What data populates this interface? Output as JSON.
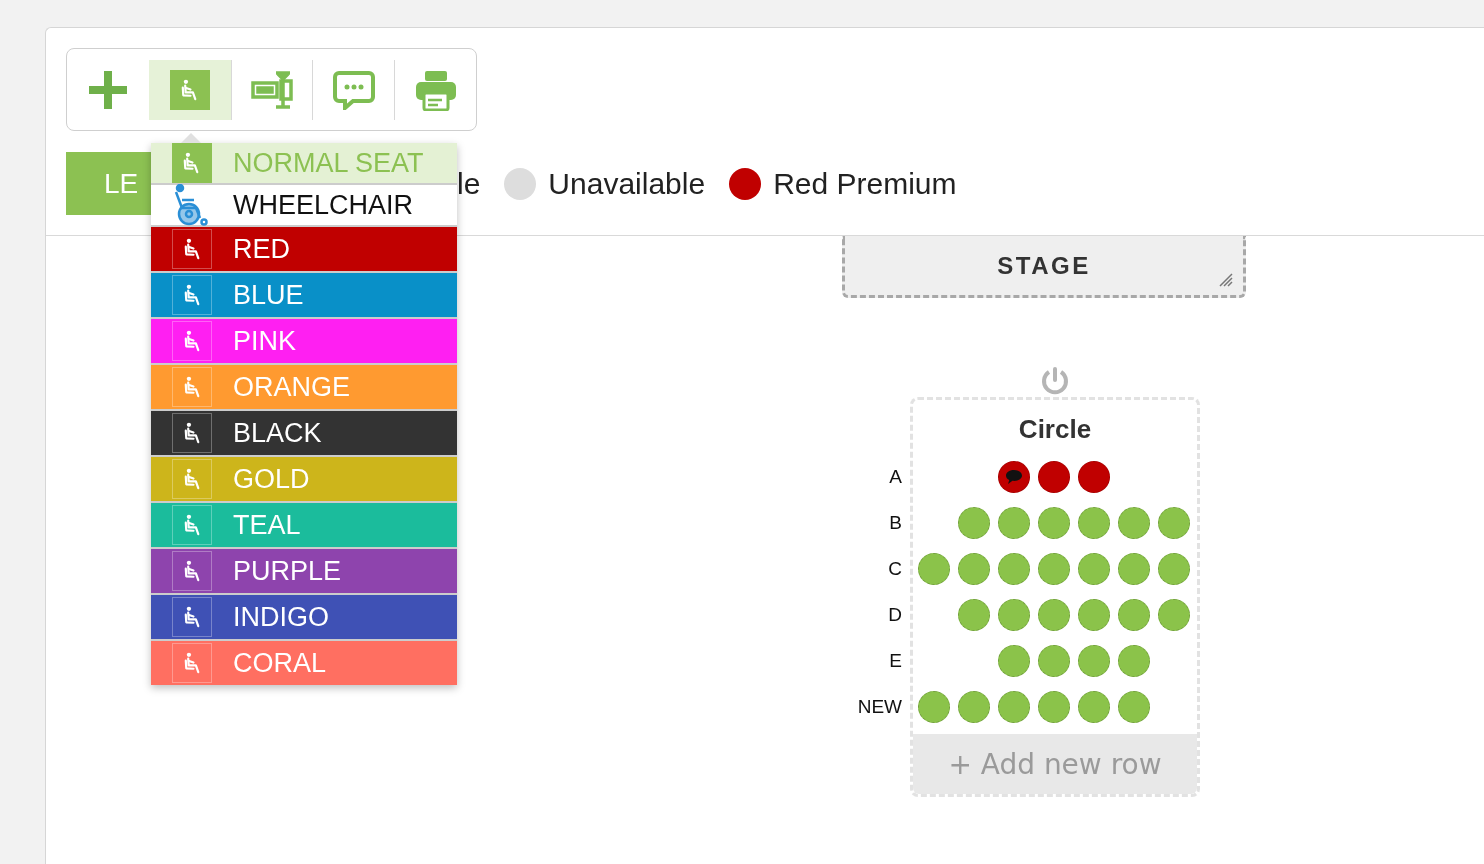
{
  "toolbar": {
    "buttons": [
      {
        "kind": "add",
        "selected": false
      },
      {
        "kind": "seat",
        "selected": true
      },
      {
        "kind": "table",
        "selected": false
      },
      {
        "kind": "comment",
        "selected": false
      },
      {
        "kind": "print",
        "selected": false
      }
    ]
  },
  "legend": {
    "button": "LE",
    "items": [
      {
        "label": "le"
      },
      {
        "label": "Unavailable",
        "color": "#dddddd"
      },
      {
        "label": "Red Premium",
        "color": "#c00000"
      }
    ]
  },
  "seat_menu": {
    "items": [
      {
        "kind": "seat",
        "label": "NORMAL SEAT",
        "selected": true,
        "color": "#e4f1d4"
      },
      {
        "kind": "wheelchair",
        "label": "WHEELCHAIR",
        "selected": false,
        "color": "#ffffff"
      },
      {
        "kind": "seat",
        "label": "RED",
        "selected": false,
        "color": "#c00000"
      },
      {
        "kind": "seat",
        "label": "BLUE",
        "selected": false,
        "color": "#0990c8"
      },
      {
        "kind": "seat",
        "label": "PINK",
        "selected": false,
        "color": "#ff1ff2"
      },
      {
        "kind": "seat",
        "label": "ORANGE",
        "selected": false,
        "color": "#ff9a30"
      },
      {
        "kind": "seat",
        "label": "BLACK",
        "selected": false,
        "color": "#333333"
      },
      {
        "kind": "seat",
        "label": "GOLD",
        "selected": false,
        "color": "#cdb51b"
      },
      {
        "kind": "seat",
        "label": "TEAL",
        "selected": false,
        "color": "#1bbc9c"
      },
      {
        "kind": "seat",
        "label": "PURPLE",
        "selected": false,
        "color": "#8e44ad"
      },
      {
        "kind": "seat",
        "label": "INDIGO",
        "selected": false,
        "color": "#3f51b5"
      },
      {
        "kind": "seat",
        "label": "CORAL",
        "selected": false,
        "color": "#ff6f61"
      }
    ]
  },
  "stage": {
    "label": "STAGE"
  },
  "section": {
    "title": "Circle",
    "add_row": "+ Add new row",
    "rows": [
      {
        "label": "A",
        "seats": [
          {
            "kind": "gap"
          },
          {
            "kind": "gap"
          },
          {
            "kind": "seat",
            "color": "#c00000",
            "note": true
          },
          {
            "kind": "seat",
            "color": "#c00000",
            "note": false
          },
          {
            "kind": "seat",
            "color": "#c00000",
            "note": false
          }
        ]
      },
      {
        "label": "B",
        "seats": [
          {
            "kind": "gap"
          },
          {
            "kind": "seat",
            "color": "#8bc34a",
            "note": false
          },
          {
            "kind": "seat",
            "color": "#8bc34a",
            "note": false
          },
          {
            "kind": "seat",
            "color": "#8bc34a",
            "note": false
          },
          {
            "kind": "seat",
            "color": "#8bc34a",
            "note": false
          },
          {
            "kind": "seat",
            "color": "#8bc34a",
            "note": false
          },
          {
            "kind": "seat",
            "color": "#8bc34a",
            "note": false
          }
        ]
      },
      {
        "label": "C",
        "seats": [
          {
            "kind": "seat",
            "color": "#8bc34a",
            "note": false
          },
          {
            "kind": "seat",
            "color": "#8bc34a",
            "note": false
          },
          {
            "kind": "seat",
            "color": "#8bc34a",
            "note": false
          },
          {
            "kind": "seat",
            "color": "#8bc34a",
            "note": false
          },
          {
            "kind": "seat",
            "color": "#8bc34a",
            "note": false
          },
          {
            "kind": "seat",
            "color": "#8bc34a",
            "note": false
          },
          {
            "kind": "seat",
            "color": "#8bc34a",
            "note": false
          }
        ]
      },
      {
        "label": "D",
        "seats": [
          {
            "kind": "gap"
          },
          {
            "kind": "seat",
            "color": "#8bc34a",
            "note": false
          },
          {
            "kind": "seat",
            "color": "#8bc34a",
            "note": false
          },
          {
            "kind": "seat",
            "color": "#8bc34a",
            "note": false
          },
          {
            "kind": "seat",
            "color": "#8bc34a",
            "note": false
          },
          {
            "kind": "seat",
            "color": "#8bc34a",
            "note": false
          },
          {
            "kind": "seat",
            "color": "#8bc34a",
            "note": false
          }
        ]
      },
      {
        "label": "E",
        "seats": [
          {
            "kind": "gap"
          },
          {
            "kind": "gap"
          },
          {
            "kind": "seat",
            "color": "#8bc34a",
            "note": false
          },
          {
            "kind": "seat",
            "color": "#8bc34a",
            "note": false
          },
          {
            "kind": "seat",
            "color": "#8bc34a",
            "note": false
          },
          {
            "kind": "seat",
            "color": "#8bc34a",
            "note": false
          }
        ]
      },
      {
        "label": "NEW",
        "seats": [
          {
            "kind": "seat",
            "color": "#8bc34a",
            "note": false
          },
          {
            "kind": "seat",
            "color": "#8bc34a",
            "note": false
          },
          {
            "kind": "seat",
            "color": "#8bc34a",
            "note": false
          },
          {
            "kind": "seat",
            "color": "#8bc34a",
            "note": false
          },
          {
            "kind": "seat",
            "color": "#8bc34a",
            "note": false
          },
          {
            "kind": "seat",
            "color": "#8bc34a",
            "note": false
          }
        ]
      }
    ]
  }
}
